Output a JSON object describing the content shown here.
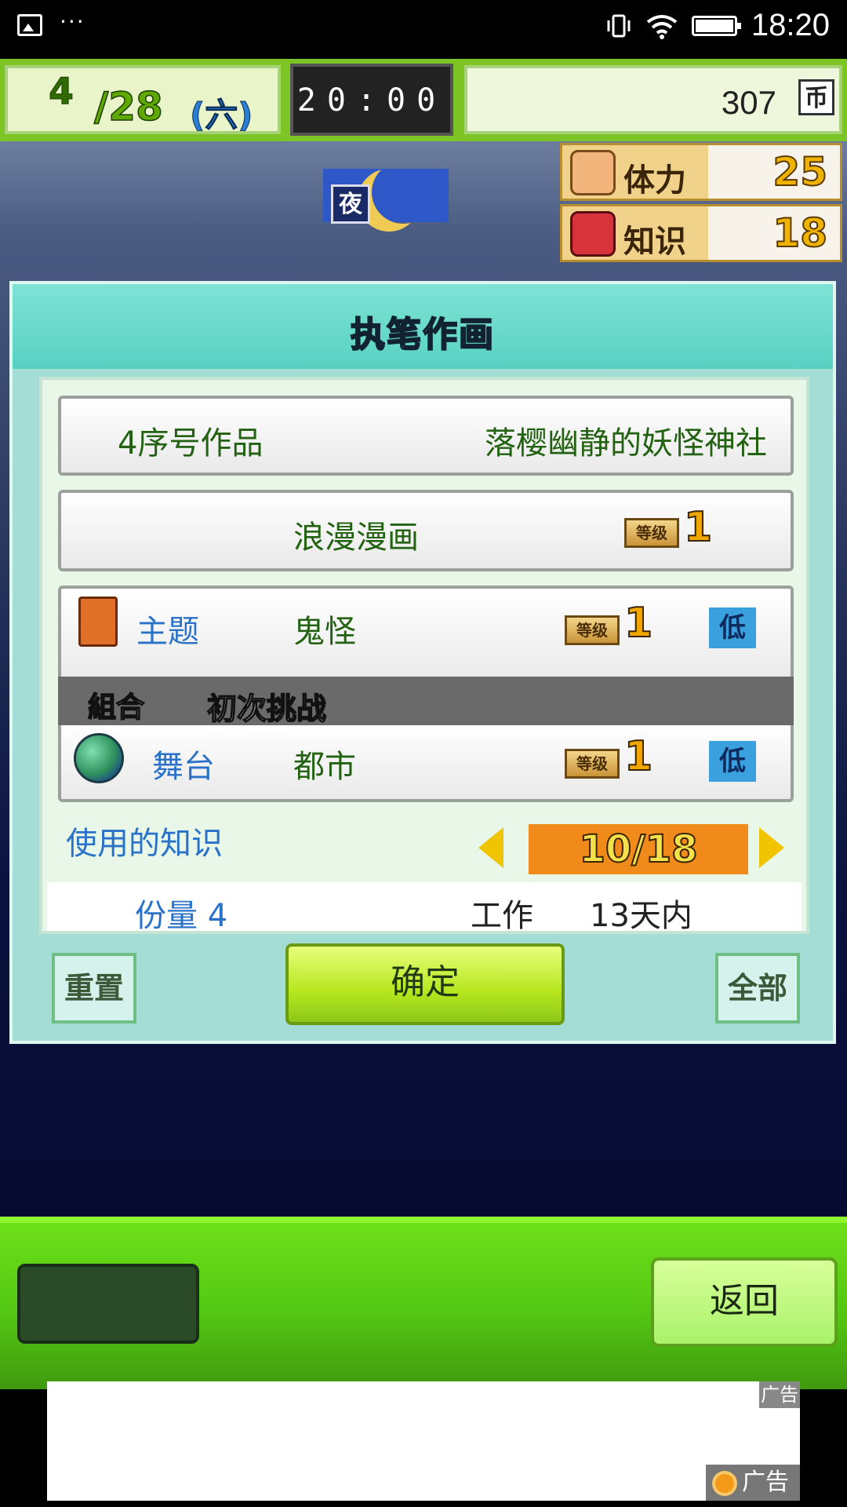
{
  "status_bar": {
    "left_more": "···",
    "time": "18:20"
  },
  "hud": {
    "month": "4",
    "day": "/28",
    "weekday": "(六)",
    "clock": "20:00",
    "money": "307",
    "money_unit": "币"
  },
  "scene": {
    "night_label": "夜",
    "stats": [
      {
        "label": "体力",
        "value": "25",
        "icon": "muscle-icon"
      },
      {
        "label": "知识",
        "value": "18",
        "icon": "book-icon"
      }
    ]
  },
  "dialog": {
    "title": "执笔作画",
    "work_number": "4序号作品",
    "work_title": "落樱幽静的妖怪神社",
    "genre": "浪漫漫画",
    "genre_level": "1",
    "theme": {
      "label": "主题",
      "value": "鬼怪",
      "level": "1",
      "tag": "低"
    },
    "combo": {
      "tag": "組合",
      "text": "初次挑战"
    },
    "stage": {
      "label": "舞台",
      "value": "都市",
      "level": "1",
      "tag": "低"
    },
    "level_tag_text": "等级",
    "knowledge": {
      "label": "使用的知识",
      "used": "10",
      "total": "18",
      "display": "10/18"
    },
    "amount": "份量 4",
    "work_label": "工作",
    "work_days": "13天内",
    "buttons": {
      "reset": "重置",
      "confirm": "确定",
      "all": "全部"
    }
  },
  "bottom": {
    "back": "返回"
  },
  "ad": {
    "tag_top": "广告",
    "tag_bottom": "广告"
  }
}
